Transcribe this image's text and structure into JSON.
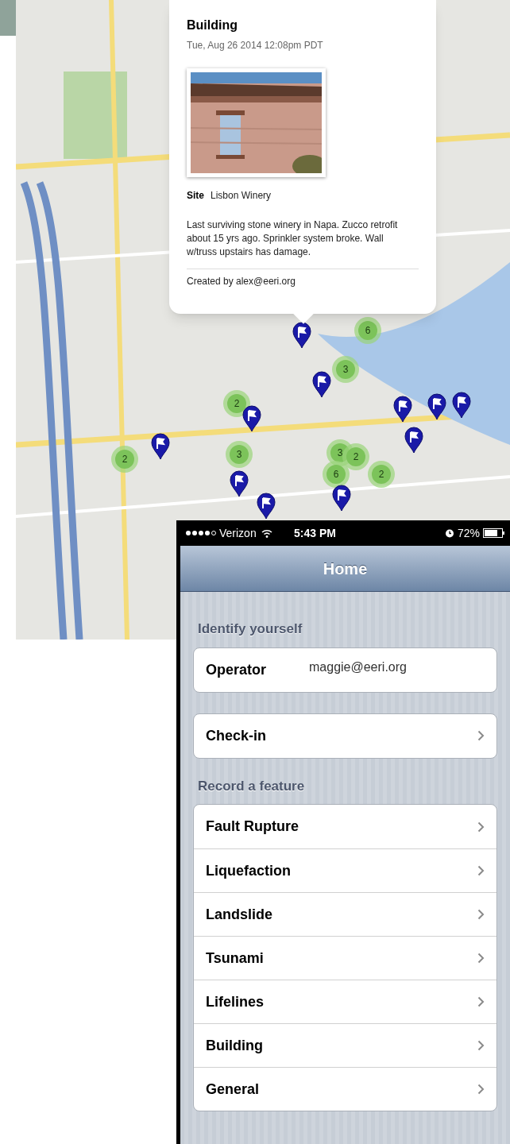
{
  "popup": {
    "title": "Building",
    "timestamp": "Tue, Aug 26 2014 12:08pm PDT",
    "fields": [
      {
        "label": "Site",
        "value": "Lisbon Winery"
      }
    ],
    "description": "Last surviving stone winery in Napa. Zucco retrofit about 15 yrs ago. Sprinkler system broke. Wall w/truss upstairs has damage.",
    "footer": "Created by alex@eeri.org"
  },
  "map_markers": [
    {
      "kind": "pin"
    },
    {
      "kind": "cluster",
      "count": "6"
    },
    {
      "kind": "cluster",
      "count": "3"
    },
    {
      "kind": "pin"
    },
    {
      "kind": "cluster",
      "count": "2"
    },
    {
      "kind": "pin"
    },
    {
      "kind": "pin"
    },
    {
      "kind": "pin"
    },
    {
      "kind": "pin"
    },
    {
      "kind": "cluster",
      "count": "2"
    },
    {
      "kind": "pin"
    },
    {
      "kind": "cluster",
      "count": "3"
    },
    {
      "kind": "cluster",
      "count": "3"
    },
    {
      "kind": "cluster",
      "count": "2"
    },
    {
      "kind": "pin"
    },
    {
      "kind": "cluster",
      "count": "6"
    },
    {
      "kind": "cluster",
      "count": "2"
    },
    {
      "kind": "pin"
    },
    {
      "kind": "pin"
    },
    {
      "kind": "pin"
    }
  ],
  "phone": {
    "status_bar": {
      "carrier": "Verizon",
      "time": "5:43 PM",
      "battery": "72%"
    },
    "nav_title": "Home",
    "sections": [
      {
        "header": "Identify yourself",
        "rows": [
          {
            "kind": "field",
            "label": "Operator",
            "value": "maggie@eeri.org"
          }
        ]
      },
      {
        "rows": [
          {
            "kind": "link",
            "label": "Check-in"
          }
        ]
      },
      {
        "header": "Record a feature",
        "rows": [
          {
            "kind": "link",
            "label": "Fault Rupture"
          },
          {
            "kind": "link",
            "label": "Liquefaction"
          },
          {
            "kind": "link",
            "label": "Landslide"
          },
          {
            "kind": "link",
            "label": "Tsunami"
          },
          {
            "kind": "link",
            "label": "Lifelines"
          },
          {
            "kind": "link",
            "label": "Building"
          },
          {
            "kind": "link",
            "label": "General"
          }
        ]
      }
    ]
  }
}
